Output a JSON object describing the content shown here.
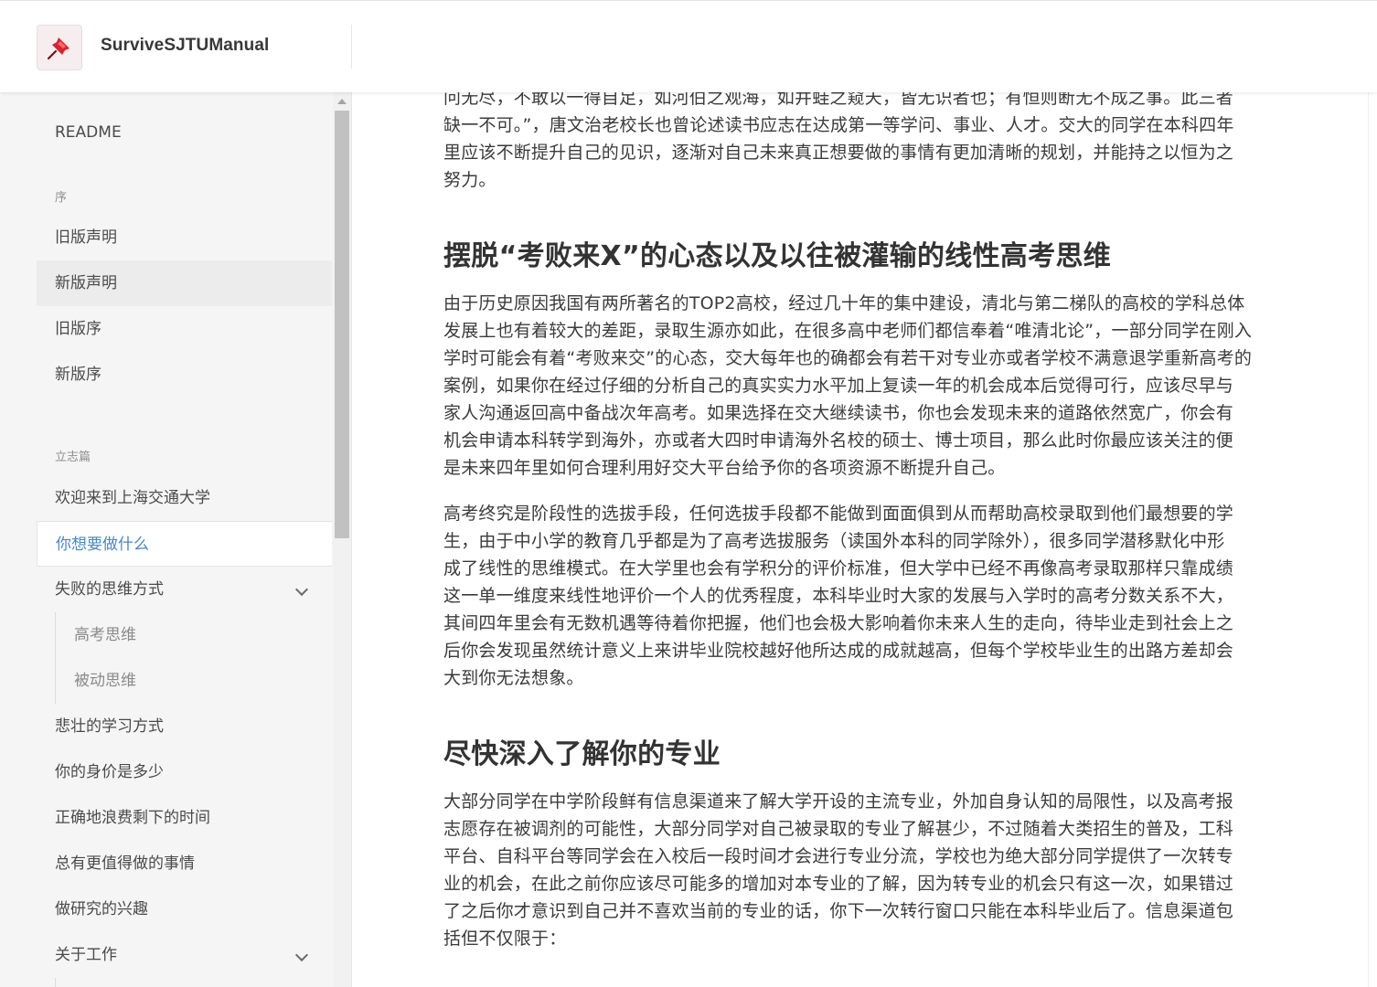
{
  "header": {
    "title": "SurviveSJTUManual",
    "logo_icon": "pushpin-icon",
    "accent": "#d9232e"
  },
  "sidebar": {
    "readme": "README",
    "section_preface": "序",
    "items_preface": [
      "旧版声明",
      "新版声明",
      "旧版序",
      "新版序"
    ],
    "section_ambition": "立志篇",
    "items_ambition": [
      "欢迎来到上海交通大学",
      "你想要做什么",
      "失败的思维方式",
      "高考思维",
      "被动思维",
      "悲壮的学习方式",
      "你的身价是多少",
      "正确地浪费剩下的时间",
      "总有更值得做的事情",
      "做研究的兴趣",
      "关于工作"
    ],
    "active_color": "#4a86c5"
  },
  "content": {
    "intro_lines": [
      "问无尽，不敢以一得自足，如河伯之观海，如井蛙之窥天，皆无识者也；有恒则断无不成之事。此三者",
      "缺一不可。”，唐文治老校长也曾论述读书应志在达成第一等学问、事业、人才。交大的同学在本科四年",
      "里应该不断提升自己的见识，逐渐对自己未来真正想要做的事情有更加清晰的规划，并能持之以恒为之",
      "努力。"
    ],
    "heading1": "摆脱“考败来X”的心态以及以往被灌输的线性高考思维",
    "para1_lines": [
      "由于历史原因我国有两所著名的TOP2高校，经过几十年的集中建设，清北与第二梯队的高校的学科总体",
      "发展上也有着较大的差距，录取生源亦如此，在很多高中老师们都信奉着“唯清北论”，一部分同学在刚入",
      "学时可能会有着“考败来交”的心态，交大每年也的确都会有若干对专业亦或者学校不满意退学重新高考的",
      "案例，如果你在经过仔细的分析自己的真实实力水平加上复读一年的机会成本后觉得可行，应该尽早与",
      "家人沟通返回高中备战次年高考。如果选择在交大继续读书，你也会发现未来的道路依然宽广，你会有",
      "机会申请本科转学到海外，亦或者大四时申请海外名校的硕士、博士项目，那么此时你最应该关注的便",
      "是未来四年里如何合理利用好交大平台给予你的各项资源不断提升自己。"
    ],
    "para2_lines": [
      "高考终究是阶段性的选拔手段，任何选拔手段都不能做到面面俱到从而帮助高校录取到他们最想要的学",
      "生，由于中小学的教育几乎都是为了高考选拔服务（读国外本科的同学除外），很多同学潜移默化中形",
      "成了线性的思维模式。在大学里也会有学积分的评价标准，但大学中已经不再像高考录取那样只靠成绩",
      "这一单一维度来线性地评价一个人的优秀程度，本科毕业时大家的发展与入学时的高考分数关系不大，",
      "其间四年里会有无数机遇等待着你把握，他们也会极大影响着你未来人生的走向，待毕业走到社会上之",
      "后你会发现虽然统计意义上来讲毕业院校越好他所达成的成就越高，但每个学校毕业生的出路方差却会",
      "大到你无法想象。"
    ],
    "heading2": "尽快深入了解你的专业",
    "para3_lines": [
      "大部分同学在中学阶段鲜有信息渠道来了解大学开设的主流专业，外加自身认知的局限性，以及高考报",
      "志愿存在被调剂的可能性，大部分同学对自己被录取的专业了解甚少，不过随着大类招生的普及，工科",
      "平台、自科平台等同学会在入校后一段时间才会进行专业分流，学校也为绝大部分同学提供了一次转专",
      "业的机会，在此之前你应该尽可能多的增加对本专业的了解，因为转专业的机会只有这一次，如果错过",
      "了之后你才意识到自己并不喜欢当前的专业的话，你下一次转行窗口只能在本科毕业后了。信息渠道包",
      "括但不仅限于："
    ]
  }
}
